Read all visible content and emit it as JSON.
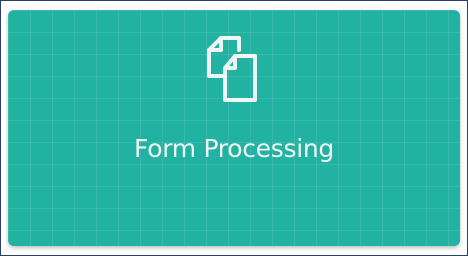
{
  "tile": {
    "label": "Form Processing",
    "icon": "documents-icon",
    "background_color": "#22b2a1",
    "text_color": "#eef7f5"
  }
}
